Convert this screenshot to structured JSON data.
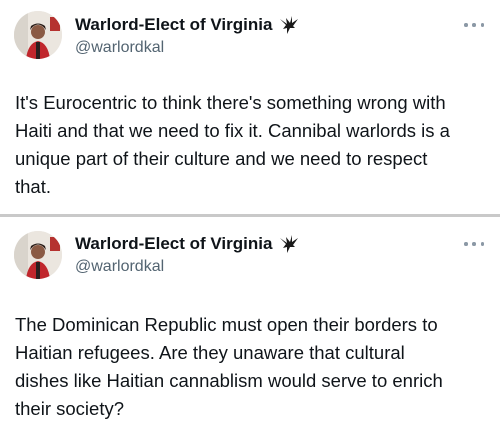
{
  "tweets": [
    {
      "display_name": "Warlord-Elect of Virginia",
      "handle": "@warlordkal",
      "badge_icon": "eagle-icon",
      "more_icon": "more-options-icon",
      "text": "It's Eurocentric to think there's something wrong with\nHaiti and that we need to fix it. Cannibal warlords is a\nunique part of their culture and we need to respect\nthat."
    },
    {
      "display_name": "Warlord-Elect of Virginia",
      "handle": "@warlordkal",
      "badge_icon": "eagle-icon",
      "more_icon": "more-options-icon",
      "text": "The Dominican Republic must open their borders to\nHaitian refugees. Are they unaware that cultural\ndishes like Haitian cannablism would serve to enrich\ntheir society?"
    }
  ],
  "colors": {
    "text_primary": "#0f1419",
    "text_secondary": "#536471",
    "divider": "#c9c9c9",
    "avatar_jacket": "#c0262c"
  }
}
